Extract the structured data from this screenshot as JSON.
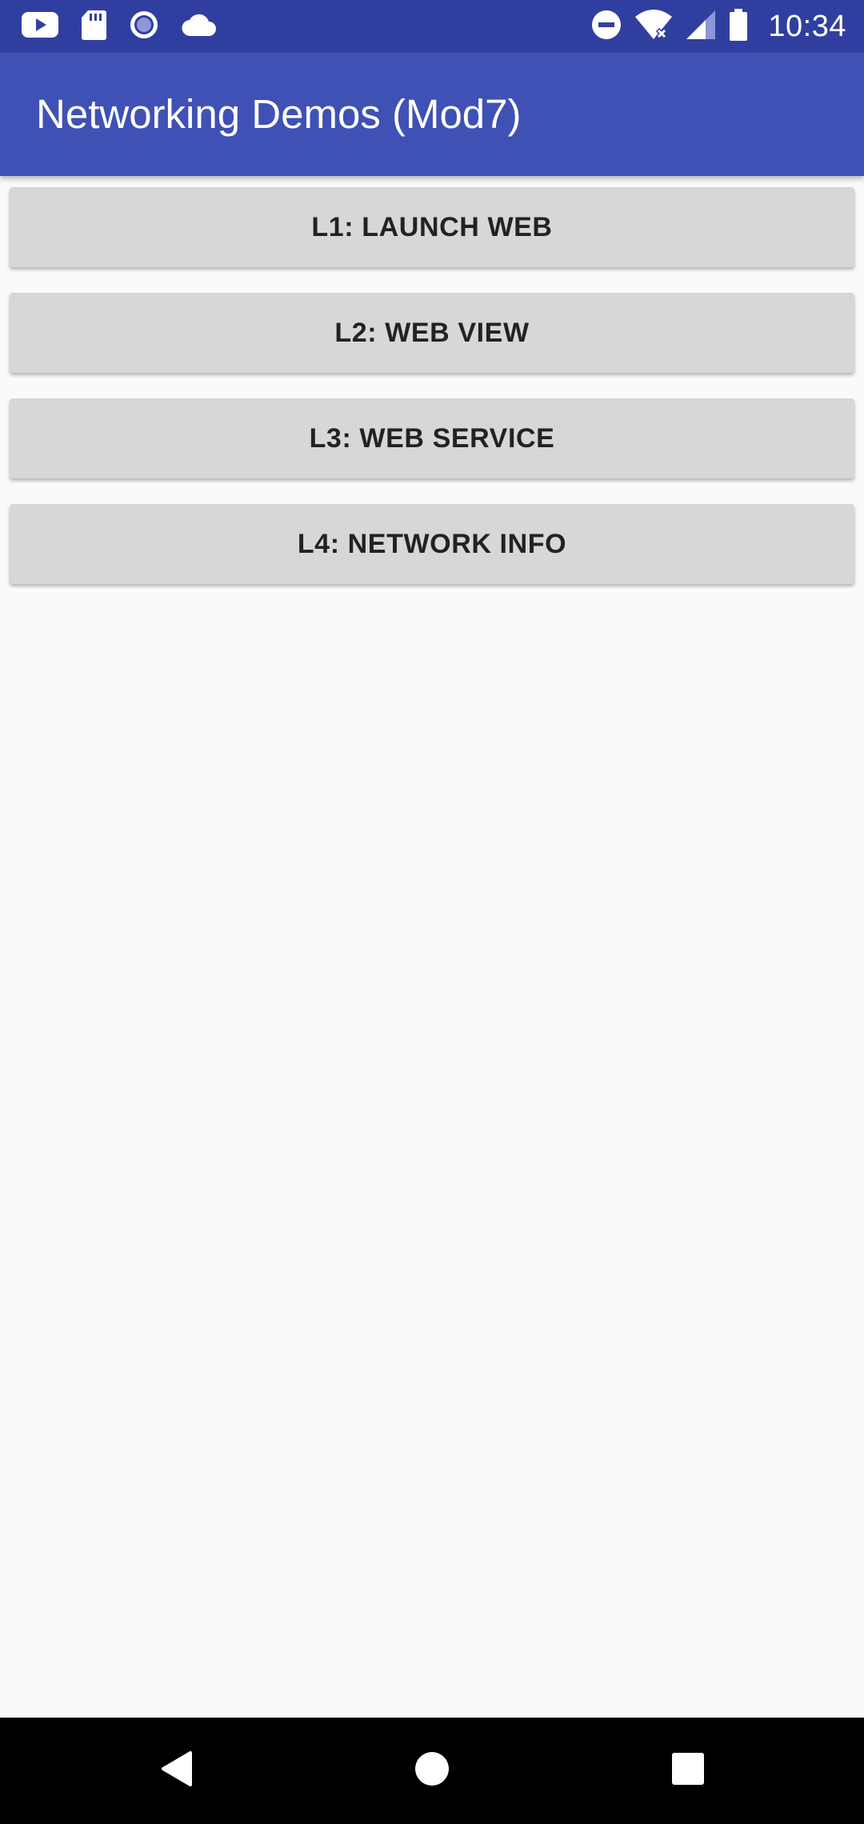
{
  "status_bar": {
    "time": "10:34",
    "left_icons": [
      "youtube-icon",
      "sd-card-icon",
      "circle-notification-icon",
      "cloud-icon"
    ],
    "right_icons": [
      "do-not-disturb-icon",
      "wifi-no-internet-icon",
      "cell-signal-icon",
      "battery-icon"
    ]
  },
  "app_bar": {
    "title": "Networking Demos (Mod7)",
    "color": "#3f51b5"
  },
  "buttons": [
    {
      "label": "L1: LAUNCH WEB"
    },
    {
      "label": "L2: WEB VIEW"
    },
    {
      "label": "L3: WEB SERVICE"
    },
    {
      "label": "L4: NETWORK INFO"
    }
  ],
  "nav_bar": {
    "icons": [
      "back-icon",
      "home-icon",
      "recents-icon"
    ]
  }
}
